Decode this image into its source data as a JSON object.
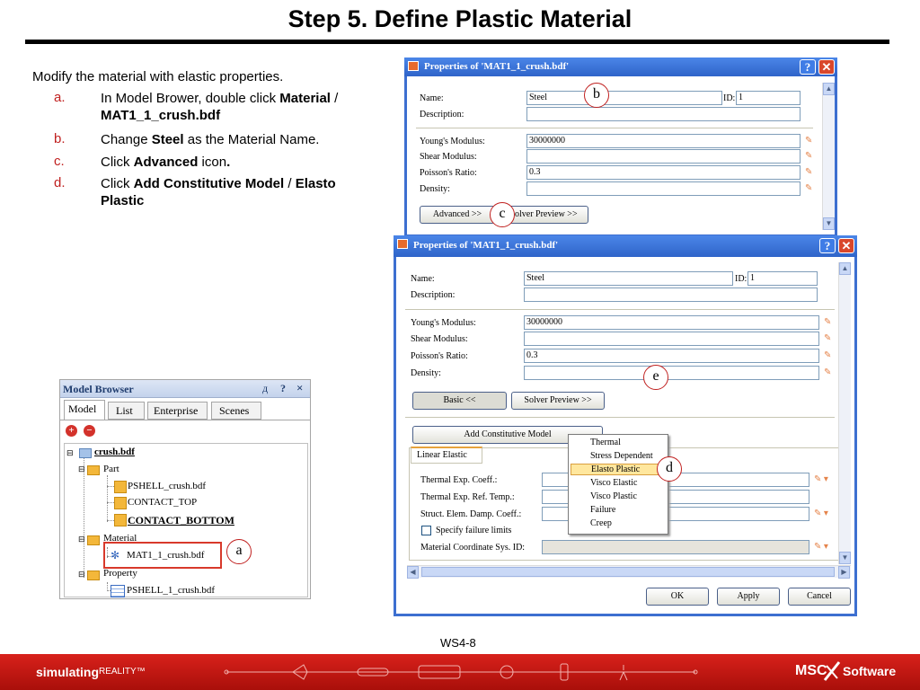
{
  "slide": {
    "title": "Step 5. Define Plastic Material",
    "intro": "Modify the material with elastic properties.",
    "page_number": "WS4-8",
    "steps": [
      {
        "letter": "a.",
        "parts": [
          {
            "t": "In Model Brower, double click ",
            "b": false
          },
          {
            "t": "Material",
            "b": true
          },
          {
            "t": " / ",
            "b": false
          },
          {
            "t": "MAT1_1_crush.bdf",
            "b": true
          }
        ]
      },
      {
        "letter": "b.",
        "parts": [
          {
            "t": "Change ",
            "b": false
          },
          {
            "t": "Steel",
            "b": true
          },
          {
            "t": " as the Material Name.",
            "b": false
          }
        ]
      },
      {
        "letter": "c.",
        "parts": [
          {
            "t": "Click ",
            "b": false
          },
          {
            "t": "Advanced",
            "b": true
          },
          {
            "t": " icon",
            "b": false
          },
          {
            "t": ".",
            "b": true
          }
        ]
      },
      {
        "letter": "d.",
        "parts": [
          {
            "t": "Click ",
            "b": false
          },
          {
            "t": "Add Constitutive Model",
            "b": true
          },
          {
            "t": " / ",
            "b": false
          },
          {
            "t": "Elasto Plastic",
            "b": true
          }
        ]
      }
    ]
  },
  "dialog1": {
    "title": "Properties of 'MAT1_1_crush.bdf'",
    "name_label": "Name:",
    "name_value": "Steel",
    "id_label": "ID:",
    "id_value": "1",
    "description_label": "Description:",
    "youngs_label": "Young's Modulus:",
    "youngs_value": "30000000",
    "shear_label": "Shear Modulus:",
    "poisson_label": "Poisson's Ratio:",
    "poisson_value": "0.3",
    "density_label": "Density:",
    "advanced_button": "Advanced >>",
    "solver_preview_button": "Solver Preview >>"
  },
  "dialog2": {
    "title": "Properties of 'MAT1_1_crush.bdf'",
    "name_label": "Name:",
    "name_value": "Steel",
    "id_label": "ID:",
    "id_value": "1",
    "description_label": "Description:",
    "youngs_label": "Young's Modulus:",
    "youngs_value": "30000000",
    "shear_label": "Shear Modulus:",
    "poisson_label": "Poisson's Ratio:",
    "poisson_value": "0.3",
    "density_label": "Density:",
    "basic_button": "Basic <<",
    "solver_preview_button": "Solver Preview >>",
    "add_model_button": "Add Constitutive Model",
    "tab_label": "Linear Elastic",
    "thermal_exp_label": "Thermal Exp. Coeff.:",
    "thermal_ref_label": "Thermal Exp. Ref. Temp.:",
    "struct_damp_label": "Struct. Elem. Damp. Coeff.:",
    "failure_checkbox_label": "Specify failure limits",
    "coord_label": "Material Coordinate Sys. ID:",
    "ok_button": "OK",
    "apply_button": "Apply",
    "cancel_button": "Cancel"
  },
  "menu": {
    "items": [
      "Thermal",
      "Stress Dependent",
      "Elasto Plastic",
      "Visco Elastic",
      "Visco Plastic",
      "Failure",
      "Creep"
    ],
    "selected": "Elasto Plastic"
  },
  "model_browser": {
    "title": "Model Browser",
    "title_buttons": [
      "д",
      "?",
      "×"
    ],
    "tabs": [
      "Model",
      "List",
      "Enterprise",
      "Scenes"
    ],
    "active_tab": "Model",
    "tree": {
      "root": "crush.bdf",
      "part": "Part",
      "part_items": [
        "PSHELL_crush.bdf",
        "CONTACT_TOP",
        "CONTACT_BOTTOM"
      ],
      "material": "Material",
      "material_item": "MAT1_1_crush.bdf",
      "property": "Property",
      "property_item": "PSHELL_1_crush.bdf"
    }
  },
  "callouts": {
    "a": "a",
    "b": "b",
    "c": "c",
    "d": "d",
    "e": "e"
  },
  "footer": {
    "left_brand": "simulating",
    "left_brand_small": "REALITY™",
    "right_brand": "MSC",
    "right_brand_suffix": "Software"
  },
  "colors": {
    "accent_red": "#c0201f",
    "footer_red": "#c8170f",
    "titlebar_blue": "#2f64c9",
    "folder_yellow": "#f3b73a"
  }
}
